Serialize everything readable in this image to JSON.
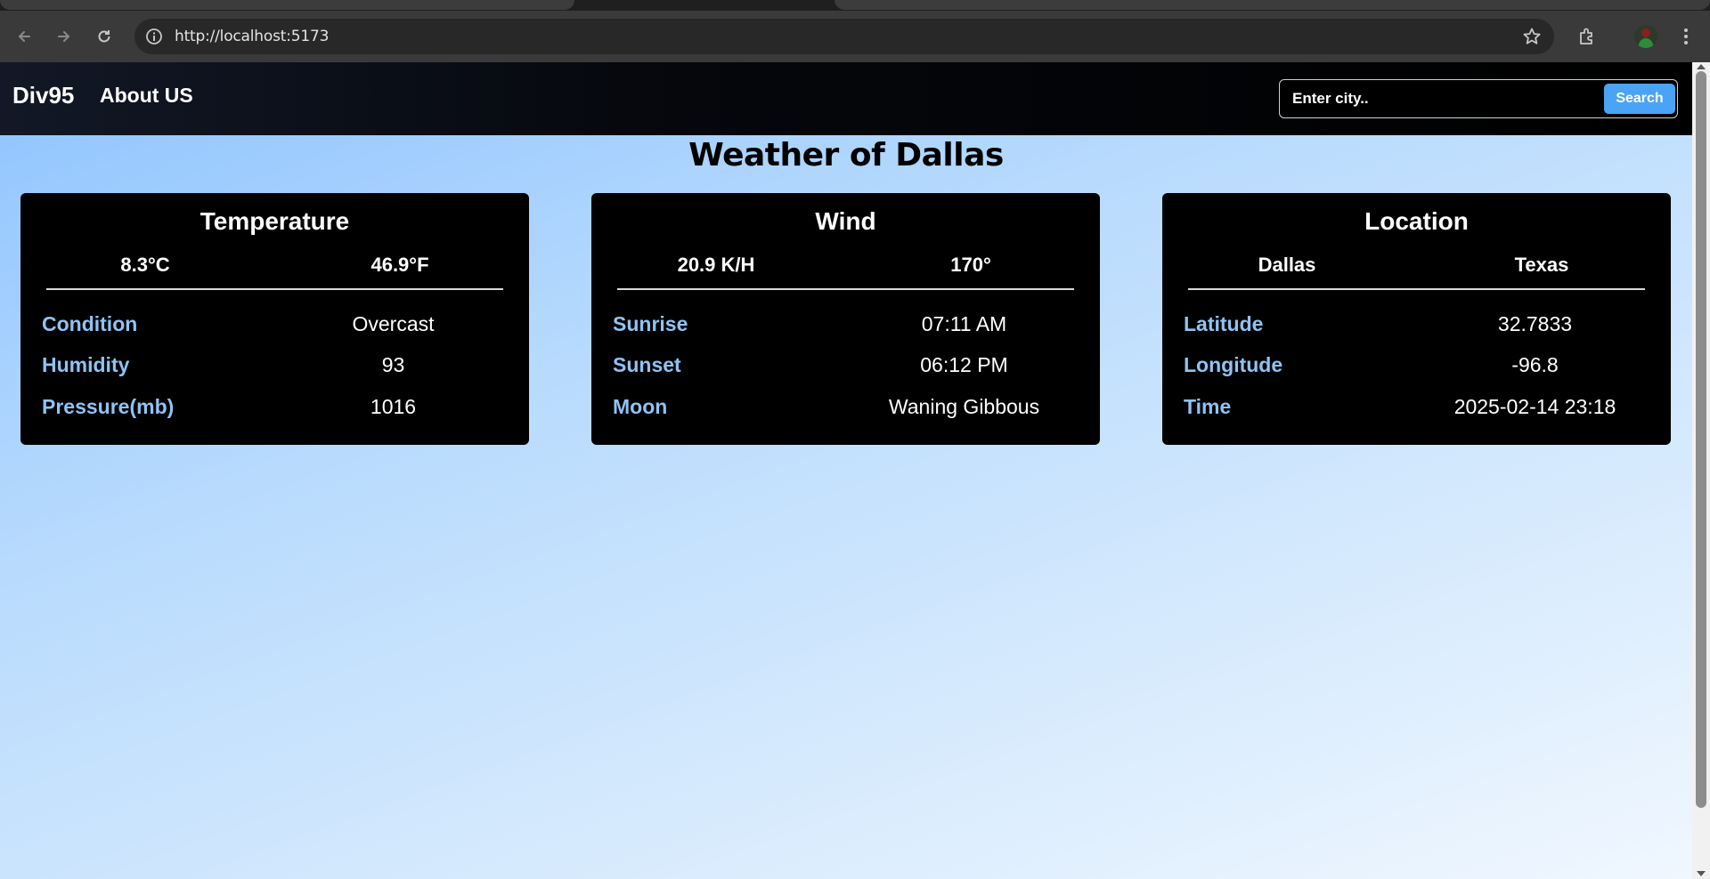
{
  "browser": {
    "url": "http://localhost:5173"
  },
  "navbar": {
    "brand": "Div95",
    "about_link": "About US",
    "search_placeholder": "Enter city..",
    "search_button": "Search"
  },
  "page": {
    "title": "Weather of Dallas"
  },
  "cards": [
    {
      "title": "Temperature",
      "sub_left": "8.3°C",
      "sub_right": "46.9°F",
      "rows": [
        {
          "label": "Condition",
          "value": "Overcast"
        },
        {
          "label": "Humidity",
          "value": "93"
        },
        {
          "label": "Pressure(mb)",
          "value": "1016"
        }
      ]
    },
    {
      "title": "Wind",
      "sub_left": "20.9 K/H",
      "sub_right": "170°",
      "rows": [
        {
          "label": "Sunrise",
          "value": "07:11 AM"
        },
        {
          "label": "Sunset",
          "value": "06:12 PM"
        },
        {
          "label": "Moon",
          "value": "Waning Gibbous"
        }
      ]
    },
    {
      "title": "Location",
      "sub_left": "Dallas",
      "sub_right": "Texas",
      "rows": [
        {
          "label": "Latitude",
          "value": "32.7833"
        },
        {
          "label": "Longitude",
          "value": "-96.8"
        },
        {
          "label": "Time",
          "value": "2025-02-14 23:18"
        }
      ]
    }
  ],
  "colors": {
    "label_accent": "#8fc3f3",
    "search_button": "#4aa3f5",
    "card_background": "#000000"
  }
}
